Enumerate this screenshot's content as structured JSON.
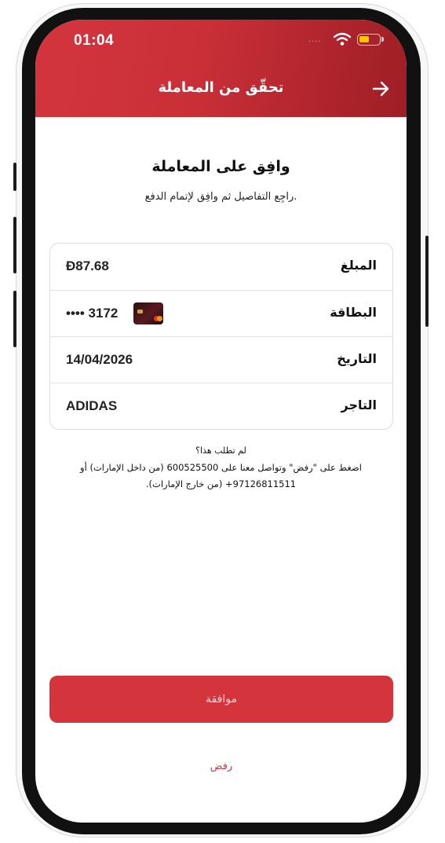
{
  "status_bar": {
    "time": "01:04",
    "signal": "....",
    "wifi_icon": "wifi-icon",
    "battery_icon": "battery-icon"
  },
  "header": {
    "title": "تحقّق من المعاملة",
    "back_icon": "arrow-right-icon"
  },
  "intro": {
    "title": "وافِق على المعاملة",
    "subtitle": "راجِع التفاصيل ثم وافِق لإتمام الدفع."
  },
  "details": [
    {
      "label": "المبلغ",
      "value": "Ð87.68"
    },
    {
      "label": "البطاقة",
      "value": "•••• 3172",
      "icon": "credit-card-icon"
    },
    {
      "label": "التاريخ",
      "value": "14/04/2026"
    },
    {
      "label": "التاجر",
      "value": "ADIDAS"
    }
  ],
  "notice": {
    "title": "لم تطلب هذا؟",
    "body": "اضغط على \"رفض\" وتواصل معنا على 600525500 (من داخل الإمارات) أو 97126811511+ (من خارج الإمارات)."
  },
  "actions": {
    "approve_label": "موافقة",
    "reject_label": "رفض"
  },
  "colors": {
    "brand_red": "#d4353d",
    "header_dark": "#9e1e25",
    "battery": "#ffc400"
  }
}
